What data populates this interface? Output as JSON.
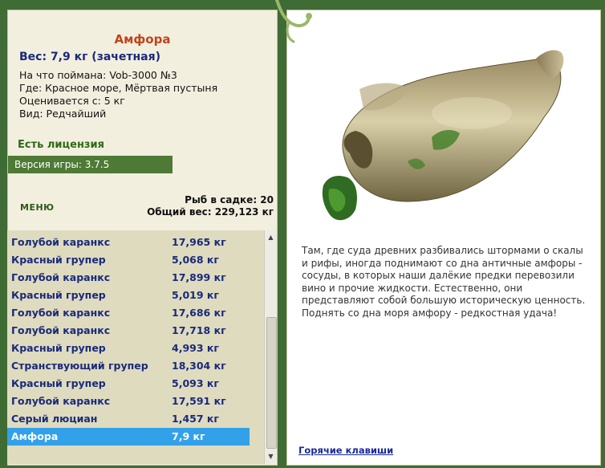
{
  "item": {
    "title": "Амфора",
    "weight_line": "Вес: 7,9 кг (зачетная)",
    "caught_on": "На что поймана: Vob-3000 №3",
    "where": "Где: Красное море, Мёртвая пустыня",
    "valued": "Оценивается с: 5 кг",
    "kind": "Вид: Редчайший"
  },
  "license": "Есть лицензия",
  "version": "Версия игры: 3.7.5",
  "menu_label": "МЕНЮ",
  "keepnet": {
    "count_line": "Рыб в садке: 20",
    "total_line": "Общий вес: 229,123 кг"
  },
  "catch_list": [
    {
      "name": "Голубой каранкс",
      "weight": "17,965 кг"
    },
    {
      "name": "Красный групер",
      "weight": "5,068 кг"
    },
    {
      "name": "Голубой каранкс",
      "weight": "17,899 кг"
    },
    {
      "name": "Красный групер",
      "weight": "5,019 кг"
    },
    {
      "name": "Голубой каранкс",
      "weight": "17,686 кг"
    },
    {
      "name": "Голубой каранкс",
      "weight": "17,718 кг"
    },
    {
      "name": "Красный групер",
      "weight": "4,993 кг"
    },
    {
      "name": "Странствующий групер",
      "weight": "18,304 кг"
    },
    {
      "name": "Красный групер",
      "weight": "5,093 кг"
    },
    {
      "name": "Голубой каранкс",
      "weight": "17,591 кг"
    },
    {
      "name": "Серый люциан",
      "weight": "1,457 кг"
    },
    {
      "name": "Амфора",
      "weight": "7,9 кг",
      "selected": true
    }
  ],
  "description": "Там, где суда древних разбивались штормами о скалы и рифы, иногда поднимают со дна античные амфоры - сосуды, в которых наши далёкие предки перевозили вино и прочие жидкости. Естественно, они представляют собой большую историческую ценность. Поднять со дна моря амфору - редкостная удача!",
  "hotkeys_link": "Горячие клавиши",
  "colors": {
    "frame": "#3f6b35",
    "panel_bg": "#f3efdf",
    "list_bg": "#dfdbbf",
    "selection": "#33a1ea",
    "title": "#c0441a",
    "list_text": "#1a2a7a"
  }
}
